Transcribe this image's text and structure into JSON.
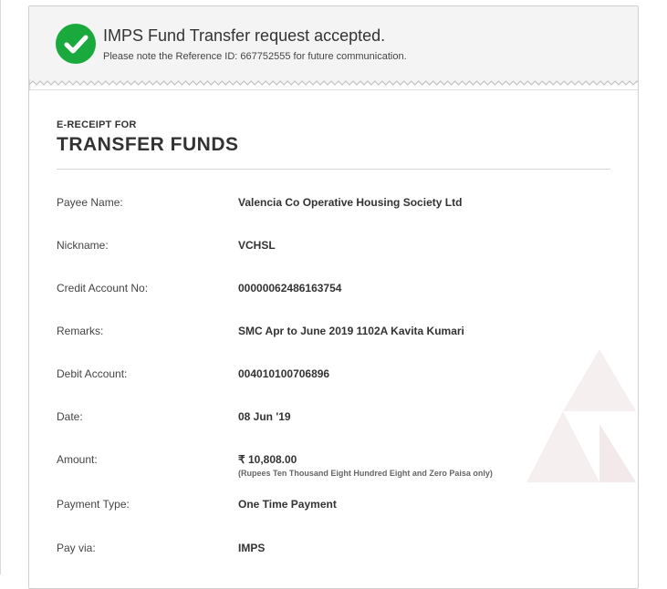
{
  "banner": {
    "title": "IMPS Fund Transfer request accepted.",
    "subtitle": "Please note the Reference ID: 667752555 for future communication.",
    "icon": "check-circle-icon",
    "icon_color": "#1aa93c"
  },
  "receipt": {
    "heading_small": "E-RECEIPT FOR",
    "heading_large": "TRANSFER FUNDS"
  },
  "details": {
    "payee_name": {
      "label": "Payee Name:",
      "value": "Valencia Co Operative Housing Society Ltd"
    },
    "nickname": {
      "label": "Nickname:",
      "value": "VCHSL"
    },
    "credit_account": {
      "label": "Credit Account No:",
      "value": "00000062486163754"
    },
    "remarks": {
      "label": "Remarks:",
      "value": "SMC Apr to June 2019 1102A Kavita Kumari"
    },
    "debit_account": {
      "label": "Debit Account:",
      "value": "004010100706896"
    },
    "date": {
      "label": "Date:",
      "value": "08 Jun '19"
    },
    "amount": {
      "label": "Amount:",
      "value": "₹ 10,808.00",
      "words": "(Rupees Ten Thousand Eight Hundred Eight and Zero Paisa only)"
    },
    "payment_type": {
      "label": "Payment Type:",
      "value": "One Time Payment"
    },
    "pay_via": {
      "label": "Pay via:",
      "value": "IMPS"
    }
  }
}
